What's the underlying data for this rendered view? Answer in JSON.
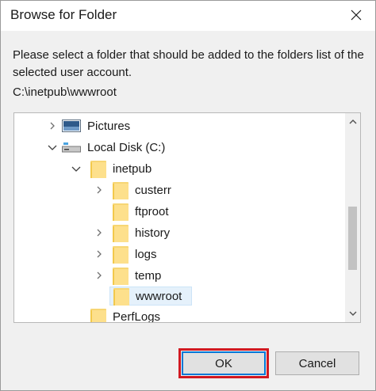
{
  "window": {
    "title": "Browse for Folder"
  },
  "instructions": "Please select a folder that should be added to the folders list of the selected user account.",
  "current_path": "C:\\inetpub\\wwwroot",
  "tree": {
    "items": [
      {
        "label": "Pictures",
        "icon": "pictures-icon",
        "expander": "collapsed"
      },
      {
        "label": "Local Disk (C:)",
        "icon": "drive-icon",
        "expander": "expanded"
      },
      {
        "label": "inetpub",
        "icon": "folder-icon",
        "expander": "expanded"
      },
      {
        "label": "custerr",
        "icon": "folder-icon",
        "expander": "collapsed"
      },
      {
        "label": "ftproot",
        "icon": "folder-icon",
        "expander": "none"
      },
      {
        "label": "history",
        "icon": "folder-icon",
        "expander": "collapsed"
      },
      {
        "label": "logs",
        "icon": "folder-icon",
        "expander": "collapsed"
      },
      {
        "label": "temp",
        "icon": "folder-icon",
        "expander": "collapsed"
      },
      {
        "label": "wwwroot",
        "icon": "folder-icon",
        "expander": "none",
        "selected": true
      },
      {
        "label": "PerfLogs",
        "icon": "folder-icon",
        "expander": "none"
      }
    ]
  },
  "buttons": {
    "ok_label": "OK",
    "cancel_label": "Cancel"
  },
  "colors": {
    "selection_bg": "#e5f1fb",
    "highlight_border": "#d11921",
    "focus_border": "#0078d7",
    "folder_yellow": "#fde08c"
  }
}
